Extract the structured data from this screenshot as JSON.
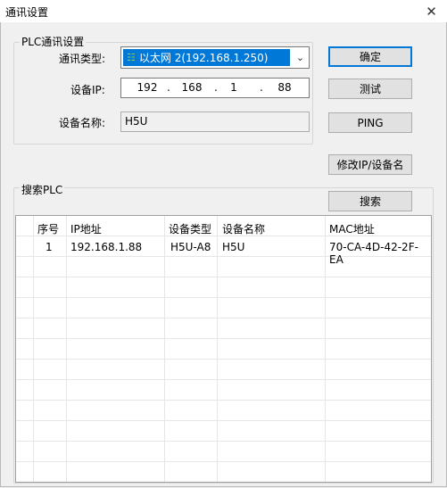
{
  "window": {
    "title": "通讯设置"
  },
  "plc_group": {
    "legend": "PLC通讯设置",
    "comm_type_label": "通讯类型:",
    "comm_type_value": "以太网 2(192.168.1.250)",
    "ip_label": "设备IP:",
    "ip": [
      "192",
      "168",
      "1",
      "88"
    ],
    "ip_dot": ".",
    "device_name_label": "设备名称:",
    "device_name_value": "H5U"
  },
  "buttons": {
    "ok": "确定",
    "test": "测试",
    "ping": "PING",
    "modify": "修改IP/设备名",
    "search": "搜索"
  },
  "search_group": {
    "legend": "搜索PLC",
    "columns": [
      "序号",
      "IP地址",
      "设备类型",
      "设备名称",
      "MAC地址"
    ],
    "rows": [
      [
        "1",
        "192.168.1.88",
        "H5U-A8",
        "H5U",
        "70-CA-4D-42-2F-EA"
      ]
    ]
  },
  "colors": {
    "selection": "#0078d7",
    "default_button_border": "#0078d7"
  },
  "icons": {
    "close": "close-icon",
    "dropdown": "chevron-down-icon",
    "network": "network-icon"
  }
}
